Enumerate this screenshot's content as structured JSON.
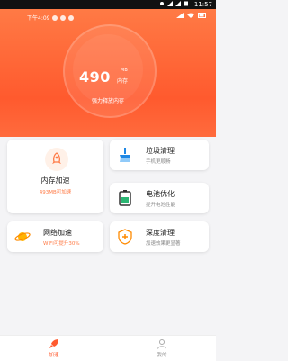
{
  "status_bar": {
    "time": "11:57"
  },
  "header": {
    "notification_time": "下午4:09",
    "memory_value": "490",
    "memory_unit": "MB",
    "memory_label": "内存",
    "memory_subtitle": "强力释放内存"
  },
  "cards": {
    "memory_boost": {
      "title": "内存加速",
      "subtitle": "493MB可加速"
    },
    "junk_clean": {
      "title": "垃圾清理",
      "subtitle": "手机更顺畅"
    },
    "battery": {
      "title": "电池优化",
      "subtitle": "提升电池性能"
    },
    "network": {
      "title": "网络加速",
      "subtitle": "WIFI可提升30%"
    },
    "deep_clean": {
      "title": "深度清理",
      "subtitle": "加速效果更显著"
    }
  },
  "tabbar": {
    "speed_label": "加速",
    "mine_label": "我的"
  },
  "colors": {
    "accent": "#ff5a2e",
    "hero_gradient_top": "#ff7a45",
    "battery_green": "#2bb673",
    "junk_blue": "#1e88e5",
    "network_orange": "#ff8a00"
  }
}
